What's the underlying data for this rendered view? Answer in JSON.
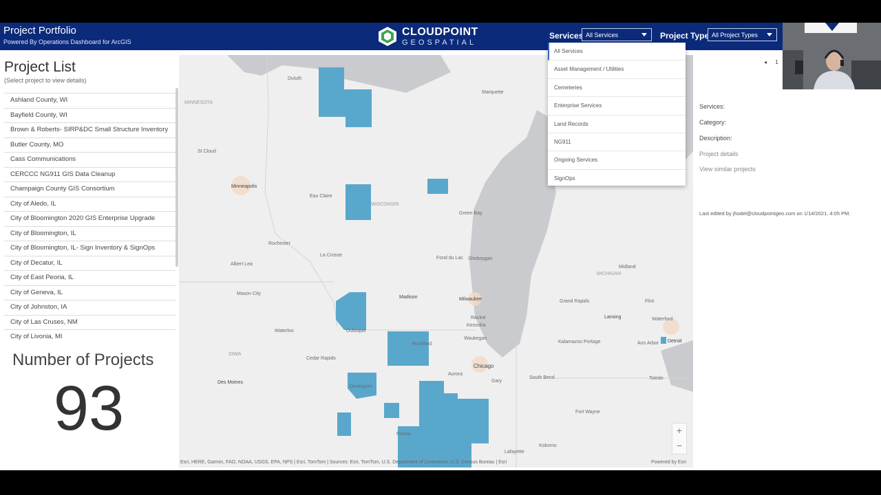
{
  "header": {
    "title": "Project Portfolio",
    "subtitle": "Powered By Operations Dashboard for ArcGIS",
    "logo_name": "CLOUDPOINT",
    "logo_sub": "GEOSPATIAL",
    "services_label": "Services",
    "services_value": "All Services",
    "project_type_label": "Project Type",
    "project_type_value": "All Project Types"
  },
  "services_dropdown": {
    "options": [
      "All Services",
      "Asset Management / Utilities",
      "Cemeteries",
      "Enterprise Services",
      "Land Records",
      "NG911",
      "Ongoing Services",
      "SignOps"
    ]
  },
  "project_list": {
    "title": "Project List",
    "subtitle": "(Select project to view details)",
    "items": [
      "Ashland County, WI",
      "Bayfield County, WI",
      "Brown & Roberts- SIRP&DC Small Structure Inventory",
      "Butler County, MO",
      "Cass Communications",
      "CERCCC NG911 GIS Data Cleanup",
      "Champaign County GIS Consortium",
      "City of Aledo, IL",
      "City of Bloomington 2020 GIS Enterprise Upgrade",
      "City of Bloomington, IL",
      "City of Bloomington, IL- Sign Inventory & SignOps",
      "City of Decatur, IL",
      "City of East Peoria, IL",
      "City of Geneva, IL",
      "City of Johnston, IA",
      "City of Las Cruses, NM",
      "City of Livonia, MI"
    ]
  },
  "indicator": {
    "title": "Number of Projects",
    "value": "93"
  },
  "map": {
    "attribution": "Esri, HERE, Garmin, FAO, NOAA, USGS, EPA, NPS | Esri, TomTom | Sources: Esri, TomTom, U.S. Department of Commerce, U.S. Census Bureau | Esri",
    "powered_by": "Powered by Esri",
    "zoom_in": "+",
    "zoom_out": "−",
    "labels": {
      "duluth": "Duluth",
      "minnesota": "MINNESOTA",
      "stcloud": "St Cloud",
      "minneapolis": "Minneapolis",
      "eauclaire": "Eau Claire",
      "wisconsin": "WISCONSIN",
      "greenbay": "Green Bay",
      "rochester": "Rochester",
      "lacrosse": "La Crosse",
      "fonddulac": "Fond du Lac",
      "sheboygan": "Sheboygan",
      "albertlea": "Albert Lea",
      "masoncity": "Mason City",
      "madison": "Madison",
      "milwaukee": "Milwaukee",
      "waterloo": "Waterloo",
      "dubuque": "Dubuque",
      "rockford": "Rockford",
      "iowa": "IOWA",
      "cedarrapids": "Cedar Rapids",
      "desmoines": "Des Moines",
      "aurora": "Aurora",
      "chicago": "Chicago",
      "gary": "Gary",
      "southbend": "South Bend",
      "fortwayne": "Fort Wayne",
      "lafayette": "Lafayette",
      "kokomo": "Kokomo",
      "peoria": "Peoria",
      "davenport": "Davenport",
      "racine": "Racine",
      "kenosha": "Kenosha",
      "waukegan": "Waukegan",
      "marquette": "Marquette",
      "midland": "Midland",
      "michigan": "MICHIGAN",
      "flint": "Flint",
      "lansing": "Lansing",
      "grandrapids": "Grand Rapids",
      "waterford": "Waterford",
      "detroit": "Detroit",
      "annarbor": "Ann Arbor",
      "kalamazoo": "Kalamazoo Portage",
      "toledo": "Toledo"
    }
  },
  "details": {
    "services": "Services:",
    "category": "Category:",
    "description": "Description:",
    "project_details": "Project details",
    "similar": "View similar projects",
    "edited": "Last edited by jhodel@cloudpointgeo.com on 1/14/2021, 4:05 PM.",
    "pager": "1"
  },
  "colors": {
    "header_bg": "#0b2a7a",
    "highlight": "#5aa7cc",
    "lake": "#c7c9cc"
  }
}
